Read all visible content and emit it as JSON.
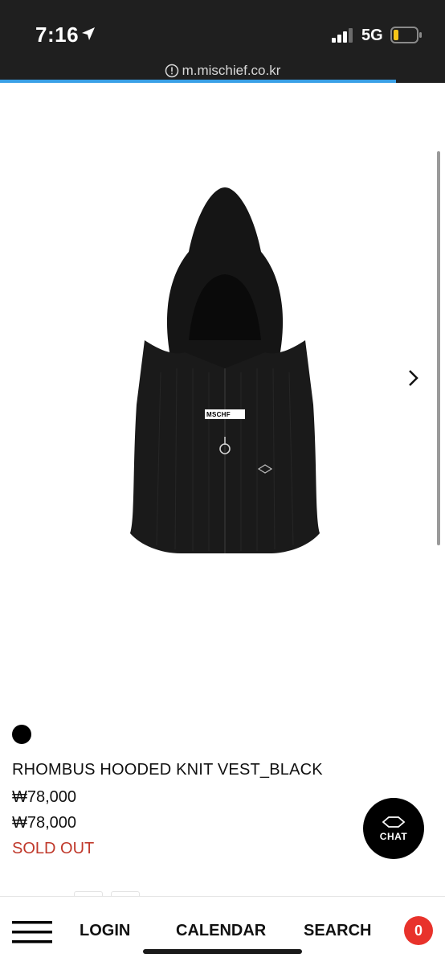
{
  "status_bar": {
    "time": "7:16",
    "network": "5G",
    "battery_color": "#f5c518"
  },
  "browser": {
    "url": "m.mischief.co.kr",
    "load_progress": 0.89
  },
  "product": {
    "label_text": "MSCHF",
    "color_swatch": "#000000",
    "name": "RHOMBUS HOODED KNIT VEST_BLACK",
    "price_original": "₩78,000",
    "price_sale": "₩78,000",
    "status": "SOLD OUT",
    "status_color": "#c0392b"
  },
  "chat": {
    "label": "CHAT"
  },
  "bottom_nav": {
    "login": "LOGIN",
    "calendar": "CALENDAR",
    "search": "SEARCH",
    "cart_count": "0"
  },
  "icons": [
    "location-arrow-icon",
    "signal-icon",
    "battery-icon",
    "info-icon",
    "chevron-right-icon",
    "rhombus-icon",
    "hamburger-menu-icon"
  ]
}
